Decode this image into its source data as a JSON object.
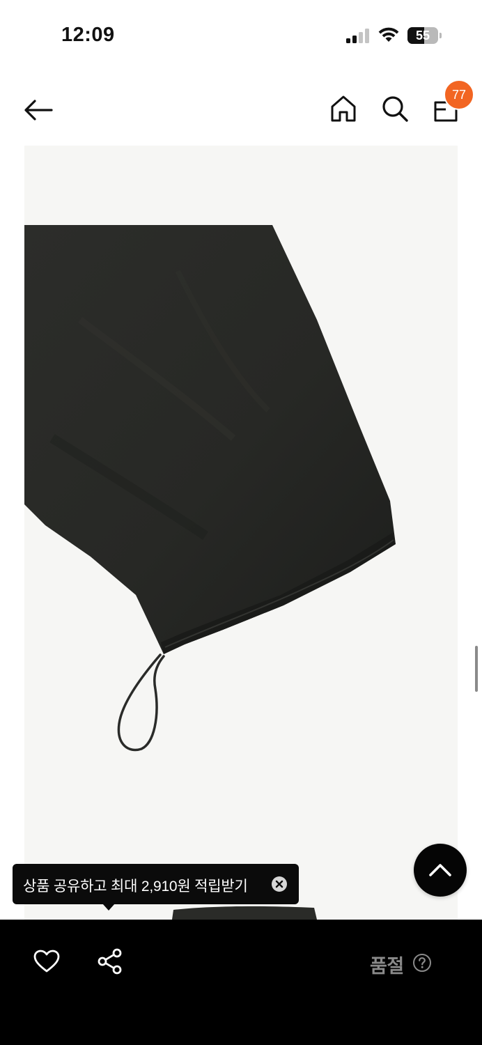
{
  "status_bar": {
    "time": "12:09",
    "battery_level": "55",
    "icons": [
      "signal-icon",
      "wifi-icon",
      "battery-icon"
    ]
  },
  "nav": {
    "back_icon": "arrow-left-icon",
    "home_icon": "home-icon",
    "search_icon": "search-icon",
    "bag_icon": "shopping-bag-icon",
    "cart_count": "77",
    "badge_color": "#f26522"
  },
  "product": {
    "image_subject": "black nylon drawstring pants hem detail",
    "image_bg": "#f6f6f4"
  },
  "tooltip": {
    "text": "상품 공유하고 최대 2,910원 적립받기",
    "close_icon": "close-circle-icon"
  },
  "scroll_top": {
    "icon": "chevron-up-icon"
  },
  "bottom_bar": {
    "like_icon": "heart-icon",
    "share_icon": "share-icon",
    "status_label": "품절",
    "help_icon": "question-circle-icon"
  }
}
